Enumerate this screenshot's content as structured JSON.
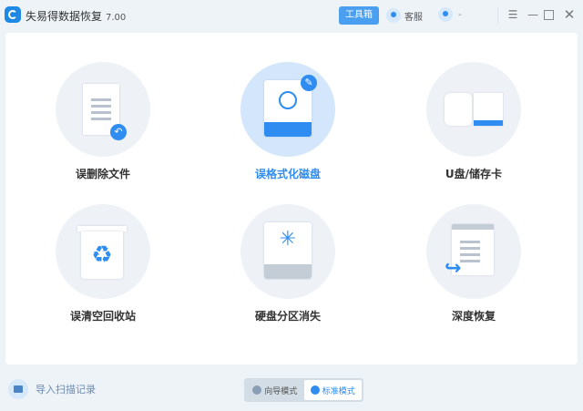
{
  "app": {
    "title": "失易得数据恢复",
    "version": "7.00"
  },
  "header": {
    "toolbox": "工具箱",
    "service": "客服",
    "account": "-"
  },
  "tiles": [
    {
      "label": "误删除文件"
    },
    {
      "label": "误格式化磁盘",
      "active": true
    },
    {
      "label": "U盘/储存卡"
    },
    {
      "label": "误清空回收站"
    },
    {
      "label": "硬盘分区消失"
    },
    {
      "label": "深度恢复"
    }
  ],
  "footer": {
    "import": "导入扫描记录",
    "modes": [
      {
        "label": "向导模式"
      },
      {
        "label": "标准模式",
        "selected": true
      }
    ]
  },
  "colors": {
    "accent": "#2f8cf0",
    "background": "#eef3f8"
  }
}
